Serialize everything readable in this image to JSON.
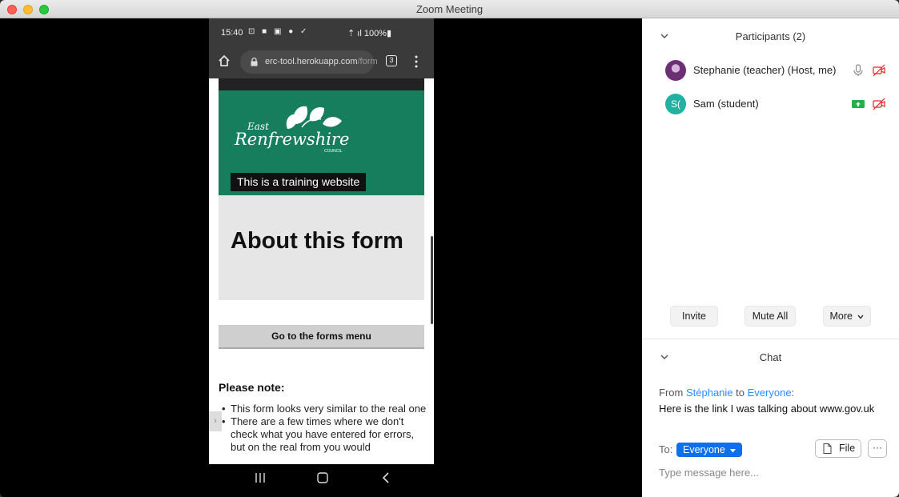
{
  "window": {
    "title": "Zoom Meeting"
  },
  "phone": {
    "status_time": "15:40",
    "status_icons": "⊡ ■ ▣ ● ✓",
    "status_right": "⇡ ıl 100%▮",
    "url_domain": "erc-tool.herokuapp.com",
    "url_path": "/form",
    "tab_count": "3",
    "training_label": "This is a training website",
    "about_title": "About this form",
    "forms_button": "Go to the forms menu",
    "note_title": "Please note:",
    "note_items": [
      "This form looks very similar to the real one",
      "There are a few times where we don't check what you have entered for errors, but on the real from you would"
    ],
    "logo": {
      "text_east": "East",
      "text_main": "Renfrewshire",
      "text_council": "COUNCIL"
    }
  },
  "participants": {
    "title": "Participants (2)",
    "list": [
      {
        "name": "Stephanie (teacher) (Host, me)",
        "avatar": "photo",
        "icons": [
          "mic-icon",
          "video-off-icon"
        ]
      },
      {
        "name": "Sam (student)",
        "avatar_letter": "S(",
        "icons": [
          "share-screen-icon",
          "video-off-icon"
        ]
      }
    ],
    "invite_label": "Invite",
    "mute_all_label": "Mute All",
    "more_label": "More"
  },
  "chat": {
    "title": "Chat",
    "from_prefix": "From",
    "from_name": "Stéphanie",
    "to_word": "to",
    "to_name": "Everyone",
    "message": "Here is the link I was talking about www.gov.uk",
    "to_label": "To:",
    "to_value": "Everyone",
    "file_label": "File",
    "more_label": "···",
    "input_placeholder": "Type message here..."
  },
  "colors": {
    "accent": "#0e71eb",
    "link": "#2d8cff",
    "banner": "#167e5c"
  }
}
